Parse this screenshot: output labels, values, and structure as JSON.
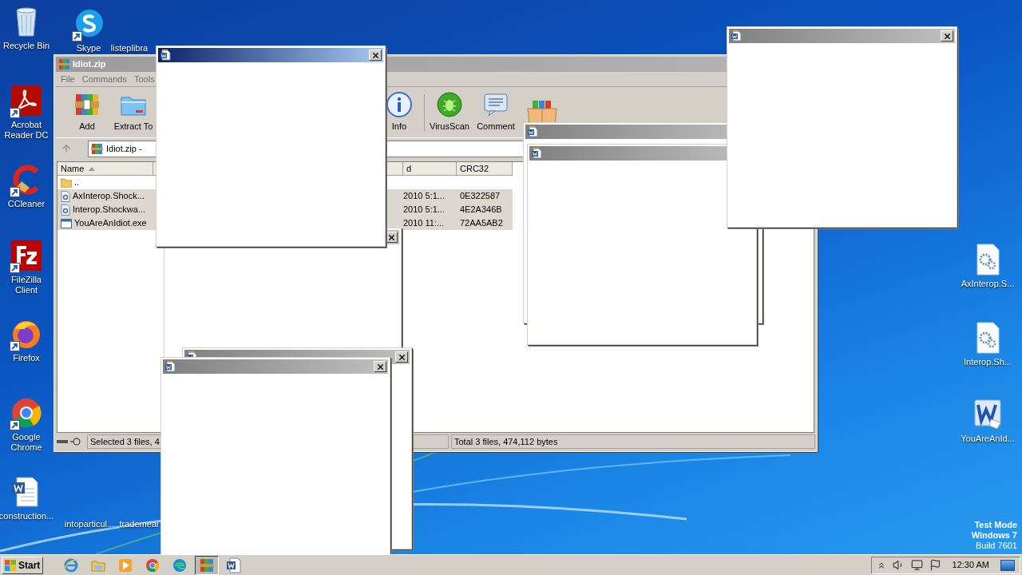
{
  "desktop": {
    "left_icons": [
      {
        "label": "Recycle Bin",
        "kind": "recycle",
        "shortcut": false
      },
      {
        "label": "Acrobat Reader DC",
        "kind": "acrobat",
        "shortcut": true
      },
      {
        "label": "CCleaner",
        "kind": "ccleaner",
        "shortcut": true
      },
      {
        "label": "FileZilla Client",
        "kind": "filezilla",
        "shortcut": true
      },
      {
        "label": "Firefox",
        "kind": "firefox",
        "shortcut": true
      },
      {
        "label": "Google Chrome",
        "kind": "chrome",
        "shortcut": true
      },
      {
        "label": "construction...",
        "kind": "worddoc",
        "shortcut": false
      }
    ],
    "top_icons": [
      {
        "label": "Skype",
        "kind": "skype",
        "shortcut": true
      },
      {
        "label": "listeplibra",
        "shortcut": false
      }
    ],
    "bottom_icons": [
      {
        "label": "intoparticul...",
        "shortcut": false
      },
      {
        "label": "trademeai",
        "shortcut": false
      }
    ],
    "right_icons": [
      {
        "label": "AxInterop.S...",
        "kind": "gearfile",
        "shortcut": false
      },
      {
        "label": "Interop.Sh...",
        "kind": "gearfile",
        "shortcut": false
      },
      {
        "label": "YouAreAnId...",
        "kind": "word",
        "shortcut": false
      }
    ],
    "os_notice": [
      {
        "text": "Test Mode",
        "bold": true
      },
      {
        "text": "Windows 7",
        "bold": true
      },
      {
        "text": "Build 7601",
        "bold": false
      }
    ]
  },
  "archive_window": {
    "title": "Idiot.zip",
    "active": false,
    "menu": [
      "File",
      "Commands",
      "Tools"
    ],
    "toolbar": [
      {
        "label": "Add",
        "kind": "add"
      },
      {
        "label": "Extract To",
        "kind": "extract"
      },
      {
        "label": "Info",
        "kind": "info"
      },
      {
        "label": "VirusScan",
        "kind": "virus"
      },
      {
        "label": "Comment",
        "kind": "comment"
      },
      {
        "kind": "sfx"
      }
    ],
    "address": "Idiot.zip -",
    "columns": [
      {
        "label": "Name",
        "sorted": true
      },
      {
        "label": "d",
        "sorted": false
      },
      {
        "label": "CRC32",
        "sorted": false
      }
    ],
    "parent_row": {
      "name": ".."
    },
    "rows": [
      {
        "name": "AxInterop.Shock...",
        "kind": "dll",
        "modified": "2010 5:1...",
        "crc": "0E322587",
        "selected": true
      },
      {
        "name": "Interop.Shockwa...",
        "kind": "dll",
        "modified": "2010 5:1...",
        "crc": "4E2A346B",
        "selected": true
      },
      {
        "name": "YouAreAnIdiot.exe",
        "kind": "exe",
        "modified": "2010 11:...",
        "crc": "72AA5AB2",
        "selected": true
      }
    ],
    "status": [
      "Selected 3 files, 4",
      "Total 3 files, 474,112 bytes"
    ]
  },
  "popups": [
    {
      "active": false
    },
    {
      "active": false
    },
    {
      "active": false
    },
    {
      "active": false
    },
    {
      "active": false
    },
    {
      "active": false
    },
    {
      "active": true
    }
  ],
  "taskbar": {
    "start": "Start",
    "apps": [
      {
        "kind": "ie",
        "selected": false
      },
      {
        "kind": "explorer",
        "selected": false
      },
      {
        "kind": "media",
        "selected": false
      },
      {
        "kind": "chrome",
        "selected": false
      },
      {
        "kind": "edge",
        "selected": false
      },
      {
        "kind": "winrar",
        "selected": true
      },
      {
        "kind": "word",
        "selected": false
      }
    ],
    "clock": "12:30 AM"
  }
}
